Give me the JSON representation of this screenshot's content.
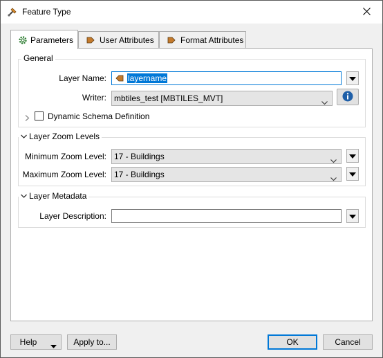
{
  "window": {
    "title": "Feature Type",
    "title_icon": "fme-transformer-icon",
    "close_icon": "close-icon"
  },
  "tabs": [
    {
      "label": "Parameters",
      "icon": "gear-icon",
      "active": true
    },
    {
      "label": "User Attributes",
      "icon": "attribute-arrow-icon",
      "active": false
    },
    {
      "label": "Format Attributes",
      "icon": "attribute-arrow-icon",
      "active": false
    }
  ],
  "general": {
    "title": "General",
    "layer_name_label": "Layer Name:",
    "layer_name_value": "layername",
    "writer_label": "Writer:",
    "writer_value": "mbtiles_test [MBTILES_MVT]",
    "dynamic_schema_label": "Dynamic Schema Definition",
    "dynamic_schema_checked": false
  },
  "zoom": {
    "title": "Layer Zoom Levels",
    "min_label": "Minimum Zoom Level:",
    "min_value": "17 - Buildings",
    "max_label": "Maximum Zoom Level:",
    "max_value": "17 - Buildings"
  },
  "metadata": {
    "title": "Layer Metadata",
    "description_label": "Layer Description:",
    "description_value": ""
  },
  "footer": {
    "help_label": "Help",
    "apply_label": "Apply to...",
    "ok_label": "OK",
    "cancel_label": "Cancel"
  },
  "colors": {
    "accent": "#0078d7",
    "info_icon": "#1f5fa8",
    "attribute_icon": "#c47a2c"
  }
}
